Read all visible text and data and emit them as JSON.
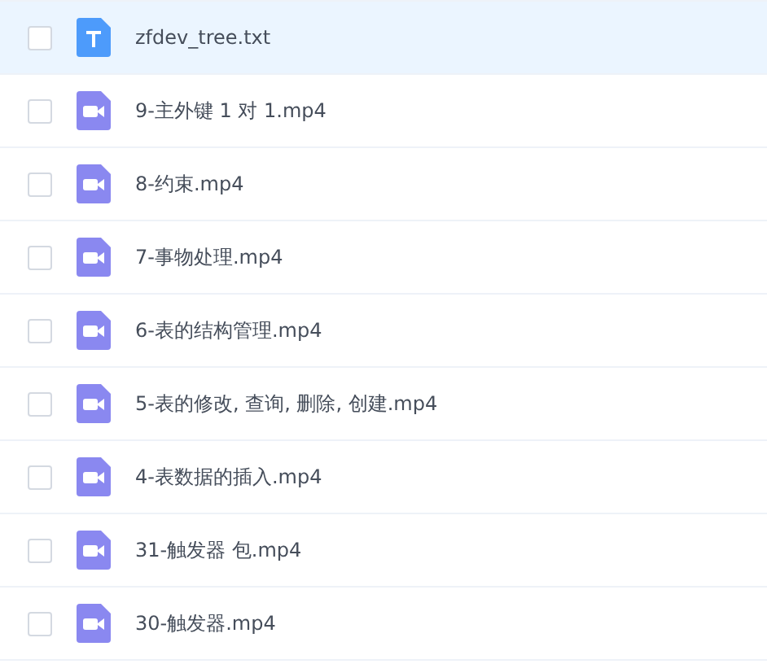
{
  "files": [
    {
      "name": "zfdev_tree.txt",
      "kind": "text",
      "selected": true,
      "checked": false
    },
    {
      "name": "9-主外键 1 对 1.mp4",
      "kind": "video",
      "selected": false,
      "checked": false
    },
    {
      "name": "8-约束.mp4",
      "kind": "video",
      "selected": false,
      "checked": false
    },
    {
      "name": "7-事物处理.mp4",
      "kind": "video",
      "selected": false,
      "checked": false
    },
    {
      "name": "6-表的结构管理.mp4",
      "kind": "video",
      "selected": false,
      "checked": false
    },
    {
      "name": "5-表的修改, 查询, 删除, 创建.mp4",
      "kind": "video",
      "selected": false,
      "checked": false
    },
    {
      "name": "4-表数据的插入.mp4",
      "kind": "video",
      "selected": false,
      "checked": false
    },
    {
      "name": "31-触发器 包.mp4",
      "kind": "video",
      "selected": false,
      "checked": false
    },
    {
      "name": "30-触发器.mp4",
      "kind": "video",
      "selected": false,
      "checked": false
    }
  ]
}
